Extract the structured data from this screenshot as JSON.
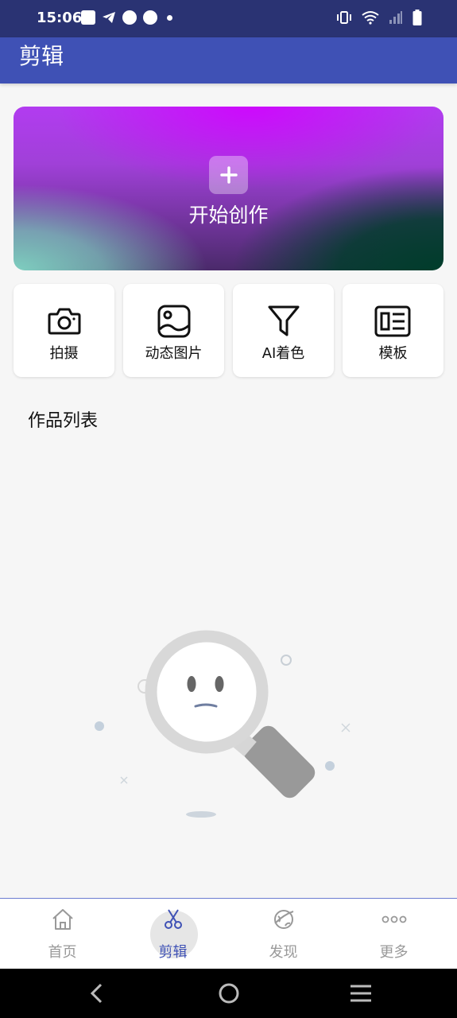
{
  "status_bar": {
    "time": "15:06",
    "left_icons": [
      "mail-icon",
      "telegram-icon",
      "speedometer-icon",
      "speedometer-icon",
      "dot-icon"
    ],
    "right_icons": [
      "vibrate-icon",
      "wifi-icon",
      "signal-icon",
      "battery-icon"
    ]
  },
  "app_bar": {
    "title": "剪辑"
  },
  "hero": {
    "label": "开始创作",
    "icon": "plus-icon"
  },
  "tools": [
    {
      "label": "拍摄",
      "icon": "camera-icon"
    },
    {
      "label": "动态图片",
      "icon": "image-icon"
    },
    {
      "label": "AI着色",
      "icon": "filter-icon"
    },
    {
      "label": "模板",
      "icon": "template-icon"
    }
  ],
  "works": {
    "title": "作品列表",
    "empty_icon": "empty-search-icon"
  },
  "bottom_nav": {
    "items": [
      {
        "label": "首页",
        "icon": "home-icon",
        "active": false
      },
      {
        "label": "剪辑",
        "icon": "scissors-icon",
        "active": true
      },
      {
        "label": "发现",
        "icon": "planet-icon",
        "active": false
      },
      {
        "label": "更多",
        "icon": "more-icon",
        "active": false
      }
    ],
    "active_color": "#3f51b5",
    "inactive_color": "#999999"
  },
  "system_nav": [
    "back-icon",
    "home-circle-icon",
    "menu-icon"
  ],
  "colors": {
    "status_bar": "#2a3373",
    "app_bar": "#3f51b5",
    "background": "#f6f6f6"
  }
}
